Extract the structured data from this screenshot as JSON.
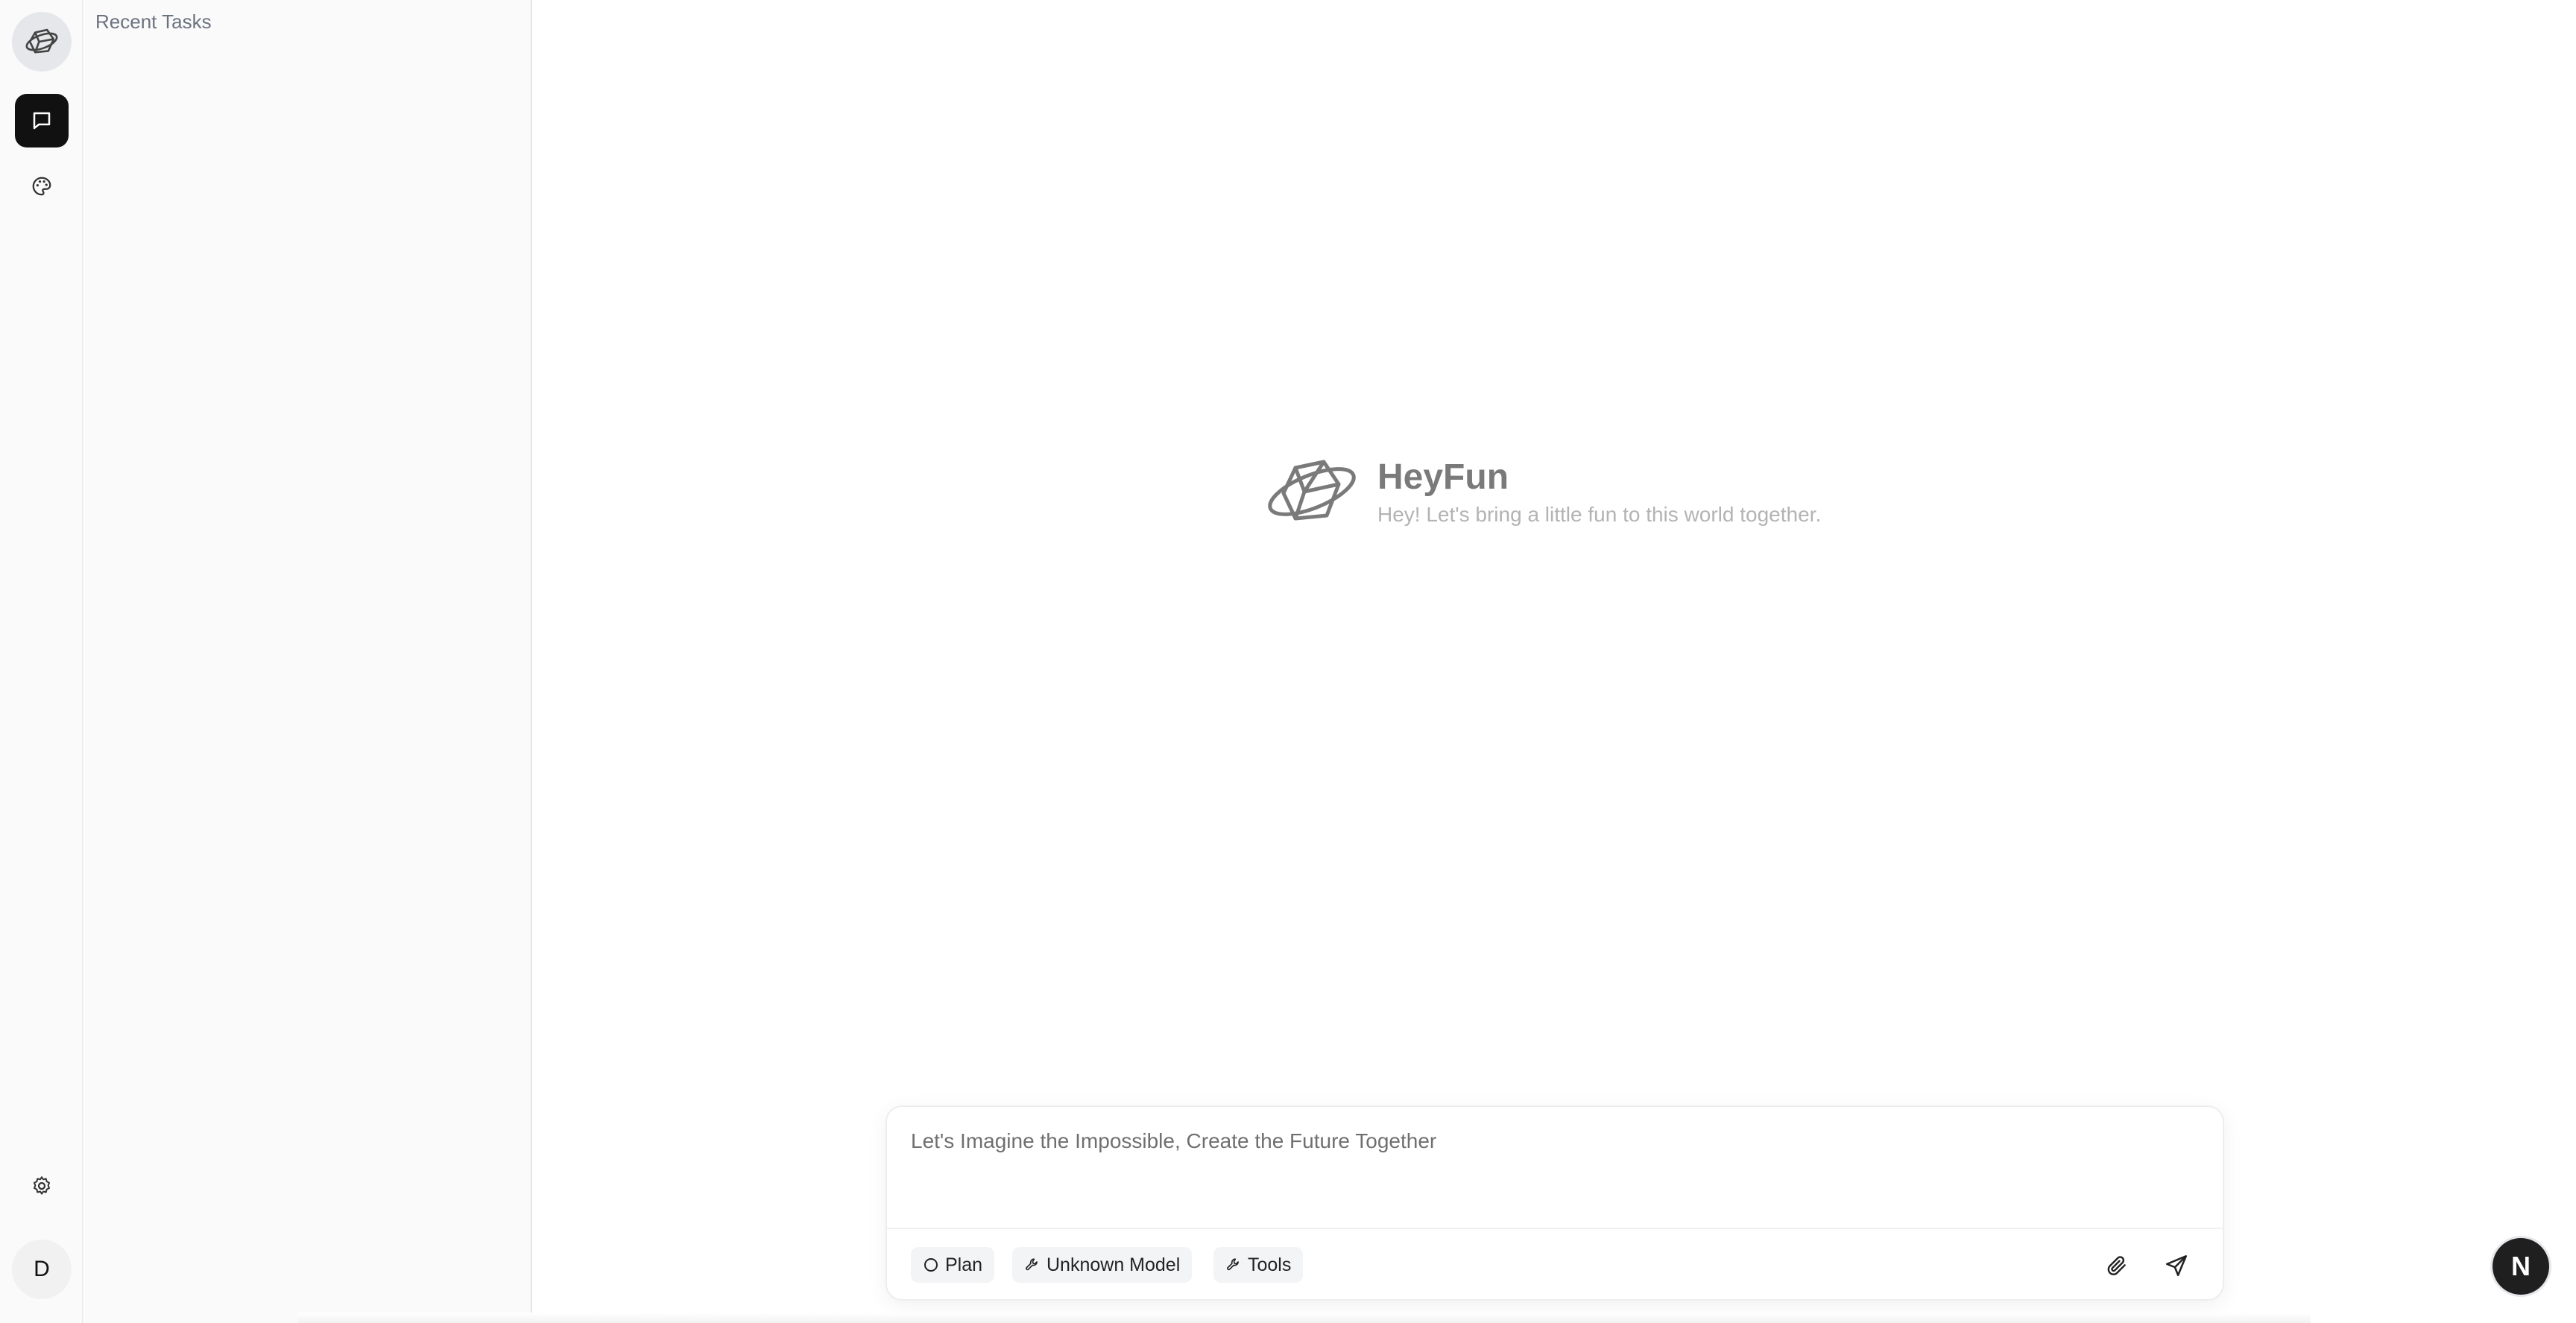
{
  "app": {
    "name": "HeyFun",
    "tagline": "Hey! Let's bring a little fun to this world together."
  },
  "rail": {
    "logo_icon": "heyfun-logo-icon",
    "items": [
      {
        "name": "chat",
        "icon": "chat-bubble-icon",
        "active": true
      },
      {
        "name": "palette",
        "icon": "palette-icon",
        "active": false
      }
    ],
    "settings_icon": "gear-icon",
    "avatar_initial": "D"
  },
  "tasks_panel": {
    "title": "Recent Tasks",
    "items": []
  },
  "composer": {
    "placeholder": "Let's Imagine the Impossible, Create the Future Together",
    "value": "",
    "chips": [
      {
        "label": "Plan",
        "icon": "circle-icon"
      },
      {
        "label": "Unknown Model",
        "icon": "wrench-icon"
      },
      {
        "label": "Tools",
        "icon": "wrench-icon"
      }
    ],
    "attach_icon": "paperclip-icon",
    "send_icon": "send-icon"
  },
  "floating_badge": {
    "letter": "N"
  },
  "colors": {
    "accent_dark": "#111111",
    "panel_bg": "#fafafa",
    "muted_text": "#6b7280"
  }
}
